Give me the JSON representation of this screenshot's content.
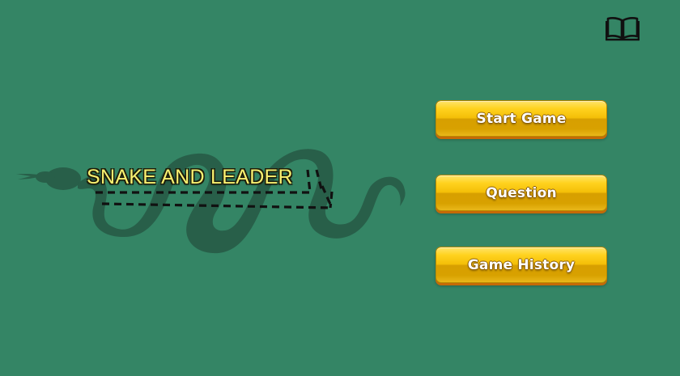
{
  "app": {
    "title": "SNAKE AND LEADER"
  },
  "toolbar": {
    "rules_icon": "book-icon"
  },
  "menu": {
    "start_label": "Start Game",
    "question_label": "Question",
    "history_label": "Game History"
  },
  "colors": {
    "background": "#348565",
    "snake": "#285f49",
    "button": "#f4bf08",
    "title_text": "#f8f070"
  }
}
